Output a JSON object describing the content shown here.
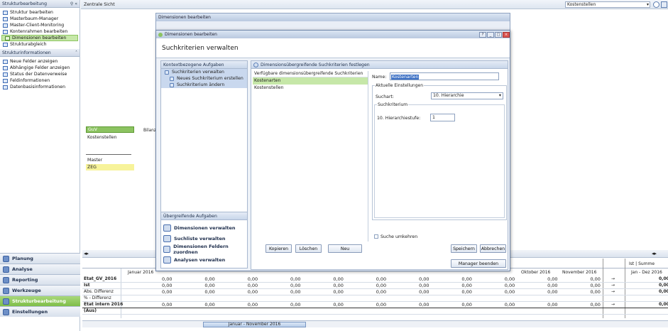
{
  "left_panel": {
    "struktur_header": "Strukturbearbeitung",
    "struktur_items": [
      {
        "label": "Struktur bearbeiten"
      },
      {
        "label": "Masterbaum-Manager"
      },
      {
        "label": "Master-Client-Monitoring"
      },
      {
        "label": "Kontenrahmen bearbeiten"
      },
      {
        "label": "Dimensionen bearbeiten"
      },
      {
        "label": "Strukturabgleich"
      }
    ],
    "info_header": "Strukturinformationen",
    "info_items": [
      {
        "label": "Neue Felder anzeigen"
      },
      {
        "label": "Abhängige Felder anzeigen"
      },
      {
        "label": "Status der Datenverweise"
      },
      {
        "label": "Feldinformationen"
      },
      {
        "label": "Datenbasisinformationen"
      }
    ],
    "bottom_nav": [
      {
        "label": "Planung"
      },
      {
        "label": "Analyse"
      },
      {
        "label": "Reporting"
      },
      {
        "label": "Werkzeuge"
      },
      {
        "label": "Strukturbearbeitung"
      },
      {
        "label": "Einstellungen"
      }
    ]
  },
  "topbar": {
    "view_title": "Zentrale Sicht",
    "combo_value": "Kostenstellen"
  },
  "tree": {
    "node_guv": "GuV",
    "node_bilanz": "Bilanz",
    "node_kostenstellen": "Kostenstellen",
    "node_master": "Master",
    "node_zeg": "ZEG"
  },
  "back_dialog": {
    "title": "Dimensionen bearbeiten"
  },
  "dialog": {
    "title": "Dimensionen bearbeiten",
    "heading": "Suchkriterien verwalten",
    "tasks_header": "Kontextbezogene Aufgaben",
    "tasks": [
      {
        "label": "Suchkriterien verwalten"
      },
      {
        "label": "Neues Suchkriterium erstellen"
      },
      {
        "label": "Suchkriterium ändern"
      }
    ],
    "global_header": "Übergreifende Aufgaben",
    "global_tasks": [
      {
        "label": "Dimensionen verwalten"
      },
      {
        "label": "Suchliste verwalten"
      },
      {
        "label": "Dimensionen Feldern zuordnen"
      },
      {
        "label": "Analysen verwalten"
      }
    ],
    "criteria_header": "Dimensionsübergreifende Suchkriterien festlegen",
    "list_header": "Verfügbare dimensionsübergreifende Suchkriterien",
    "list_items": [
      "Kostenarten",
      "Kostenstellen"
    ],
    "name_label": "Name:",
    "name_value": "Kostenarten",
    "current_settings": "Aktuelle Einstellungen",
    "suchart_label": "Suchart:",
    "suchart_value": "10. Hierarchie",
    "suchkriterium_label": "Suchkriterium",
    "level_label": "10. Hierarchiestufe:",
    "level_value": "1",
    "invert_label": "Suche umkehren",
    "btn_kopieren": "Kopieren",
    "btn_loeschen": "Löschen",
    "btn_neu": "Neu",
    "btn_speichern": "Speichern",
    "btn_abbrechen": "Abbrechen",
    "btn_beenden": "Manager beenden"
  },
  "grid": {
    "col_jan": "Januar 2016",
    "col_okt": "Oktober 2016",
    "col_nov": "November 2016",
    "col_sum_head": "Ist | Summe",
    "col_sum": "Jan - Dez 2016",
    "rows": [
      "Etat_GV_2016",
      "Ist",
      "Abs. Differenz",
      "% - Differenz",
      "Etat intern 2016",
      "(Aus)"
    ],
    "zero": "0,00",
    "arrow": "→",
    "hscroll_label": "Januar - November 2016"
  },
  "colors": {
    "accent_green": "#8cc361",
    "header_blue": "#c8d6ea",
    "close_red": "#d9534f"
  }
}
